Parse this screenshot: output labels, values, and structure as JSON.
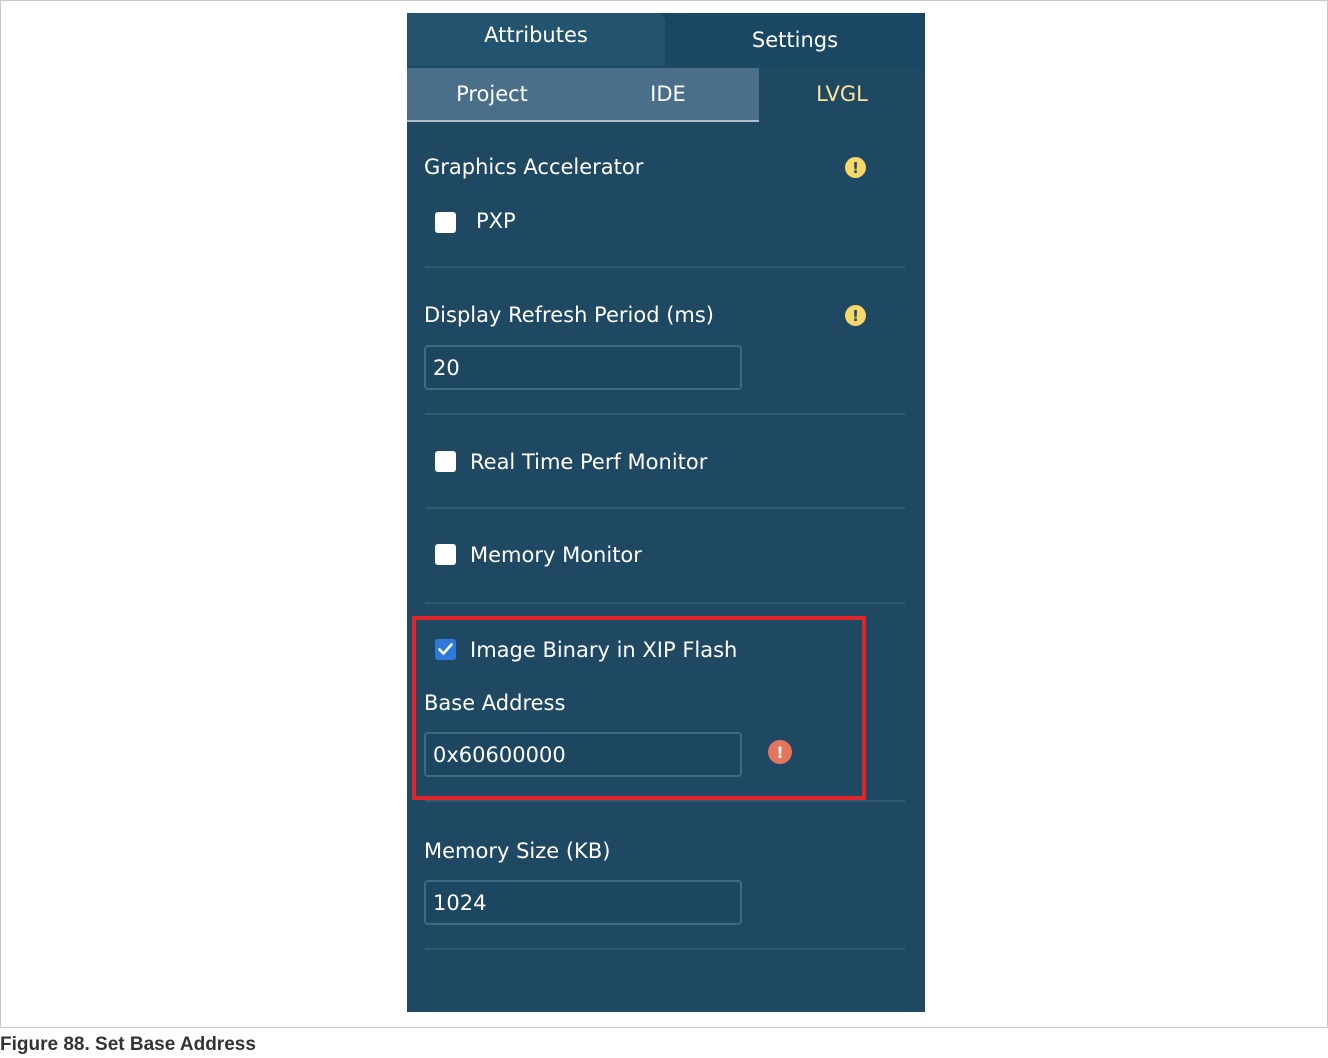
{
  "tabs": {
    "attributes": "Attributes",
    "settings": "Settings"
  },
  "subtabs": {
    "project": "Project",
    "ide": "IDE",
    "lvgl": "LVGL"
  },
  "graphics_accelerator": {
    "label": "Graphics Accelerator",
    "option_label": "PXP",
    "checked": false
  },
  "display_refresh": {
    "label": "Display Refresh Period  (ms)",
    "value": "20"
  },
  "real_time_perf": {
    "label": "Real Time Perf Monitor",
    "checked": false
  },
  "memory_monitor": {
    "label": "Memory Monitor",
    "checked": false
  },
  "image_binary": {
    "label": "Image Binary in XIP Flash",
    "checked": true
  },
  "base_address": {
    "label": "Base Address",
    "value": "0x60600000"
  },
  "memory_size": {
    "label": "Memory Size (KB)",
    "value": "1024"
  },
  "icons": {
    "warning": "!",
    "error": "!"
  },
  "caption": "Figure 88.  Set Base Address",
  "colors": {
    "panel": "#1f4963",
    "active_tab_text": "#ffe19a",
    "highlight": "#e0242a",
    "warning": "#f5d76a",
    "error": "#e4765e"
  }
}
